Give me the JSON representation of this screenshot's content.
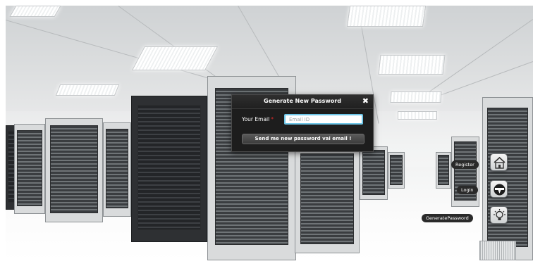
{
  "modal": {
    "title": "Generate New Password",
    "close_symbol": "✖",
    "email_label": "Your Email",
    "required_mark": "*",
    "email_placeholder": "Email ID",
    "email_value": "",
    "submit_label": "Send me new password vai email !"
  },
  "nav": {
    "register_label": "Register",
    "login_label": "Login",
    "generate_label": "GeneratePassword",
    "register_icon": "house-icon",
    "login_icon": "login-circle-icon",
    "generate_icon": "lightbulb-icon"
  },
  "colors": {
    "modal_bg": "#1d1d1d",
    "input_border": "#6ec6e8",
    "required": "#e32a2a",
    "pill_bg": "#2a2a2a"
  }
}
